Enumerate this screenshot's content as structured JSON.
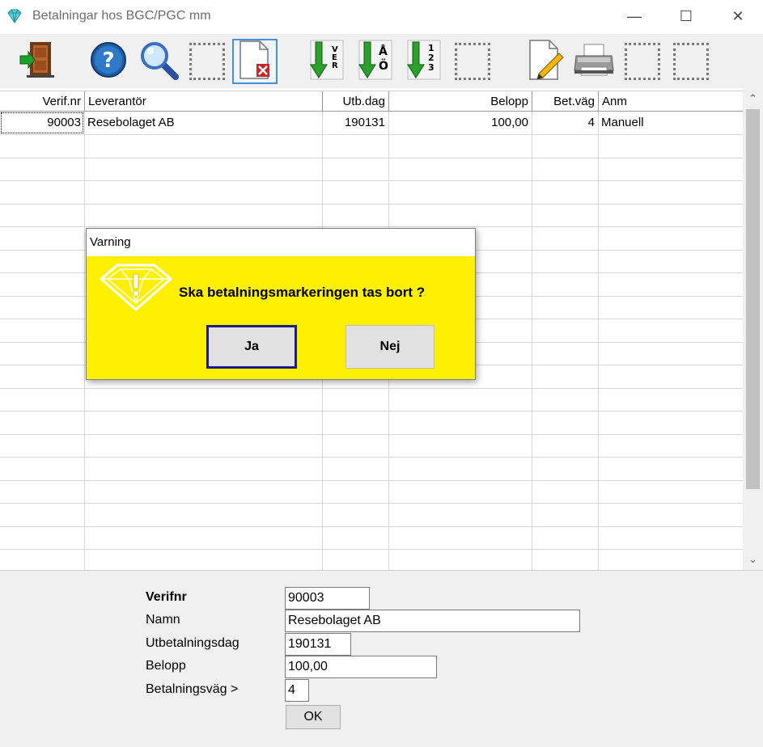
{
  "window": {
    "title": "Betalningar hos BGC/PGC mm",
    "minimize_glyph": "—",
    "maximize_glyph": "☐",
    "close_glyph": "✕",
    "icon": "diamond-icon"
  },
  "toolbar": {
    "buttons": [
      {
        "icon": "exit-door-icon"
      },
      {
        "icon": "help-icon"
      },
      {
        "icon": "search-icon"
      },
      {
        "icon": "empty-slot"
      },
      {
        "icon": "delete-document-icon",
        "selected": true
      },
      {
        "icon": "sort-verifnr-icon",
        "label": "VERnr"
      },
      {
        "icon": "sort-alpha-icon",
        "label": "AÖ"
      },
      {
        "icon": "sort-numeric-icon",
        "label": "123"
      },
      {
        "icon": "empty-slot"
      },
      {
        "icon": "edit-document-icon"
      },
      {
        "icon": "print-icon"
      },
      {
        "icon": "empty-slot"
      },
      {
        "icon": "empty-slot"
      }
    ]
  },
  "grid": {
    "columns": [
      "Verif.nr",
      "Leverantör",
      "Utb.dag",
      "Belopp",
      "Bet.väg",
      "Anm"
    ],
    "rows": [
      {
        "verifnr": "90003",
        "leverantor": "Resebolaget AB",
        "utbdag": "190131",
        "belopp": "100,00",
        "betvag": "4",
        "anm": "Manuell"
      }
    ]
  },
  "scrollbar": {
    "up_glyph": "⌃",
    "down_glyph": "⌄"
  },
  "form": {
    "verifnr_label": "Verifnr",
    "verifnr_value": "90003",
    "namn_label": "Namn",
    "namn_value": "Resebolaget AB",
    "utbetalningsdag_label": "Utbetalningsdag",
    "utbetalningsdag_value": "190131",
    "belopp_label": "Belopp",
    "belopp_value": "100,00",
    "betalningsvag_label": "Betalningsväg >",
    "betalningsvag_value": "4",
    "ok_label": "OK"
  },
  "dialog": {
    "title": "Varning",
    "message": "Ska betalningsmarkeringen tas bort ?",
    "yes_label": "Ja",
    "no_label": "Nej",
    "icon": "warning-diamond-icon"
  },
  "colors": {
    "dialog_background": "#fff000",
    "toolbar_background": "#f0f0f0",
    "focus_border": "#1c1c8a"
  }
}
